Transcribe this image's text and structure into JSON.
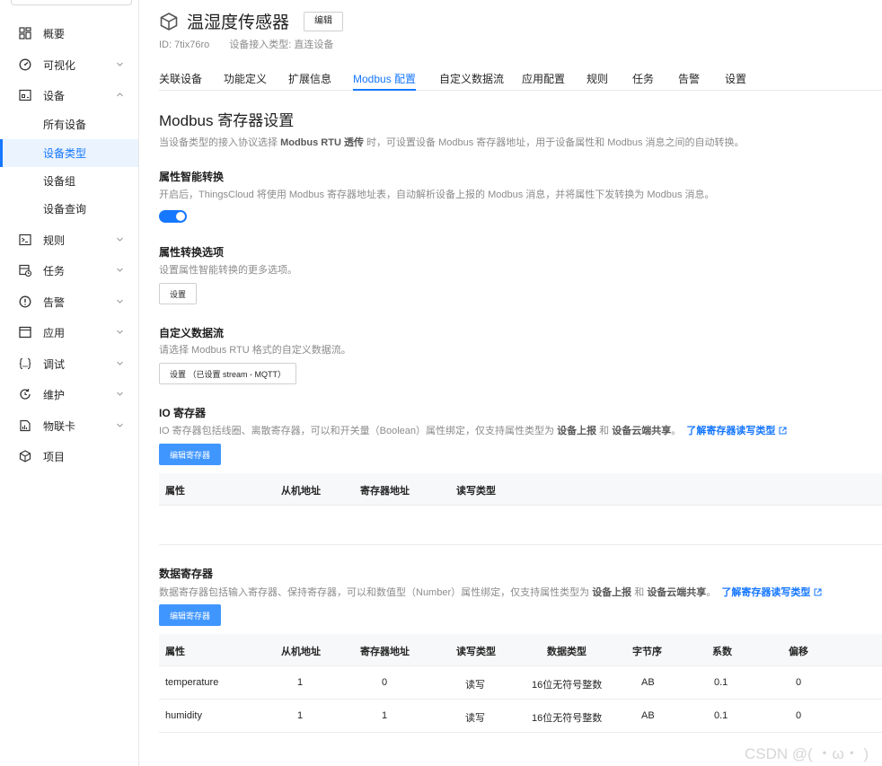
{
  "sidebar": {
    "items": [
      {
        "label": "概要",
        "icon": "dashboard-icon"
      },
      {
        "label": "可视化",
        "icon": "gauge-icon",
        "chevron": "down"
      },
      {
        "label": "设备",
        "icon": "device-icon",
        "chevron": "up"
      },
      {
        "label": "规则",
        "icon": "terminal-icon",
        "chevron": "down"
      },
      {
        "label": "任务",
        "icon": "task-icon",
        "chevron": "down"
      },
      {
        "label": "告警",
        "icon": "alert-icon",
        "chevron": "down"
      },
      {
        "label": "应用",
        "icon": "app-window-icon",
        "chevron": "down"
      },
      {
        "label": "调试",
        "icon": "debug-braces-icon",
        "chevron": "down"
      },
      {
        "label": "维护",
        "icon": "maintenance-icon",
        "chevron": "down"
      },
      {
        "label": "物联卡",
        "icon": "sim-card-icon",
        "chevron": "down"
      },
      {
        "label": "项目",
        "icon": "project-cube-icon"
      }
    ],
    "device_subitems": [
      "所有设备",
      "设备类型",
      "设备组",
      "设备查询"
    ],
    "active_subitem": "设备类型"
  },
  "header": {
    "title": "温湿度传感器",
    "edit_label": "编辑",
    "id_text": "ID: 7tix76ro",
    "access_type_text": "设备接入类型: 直连设备"
  },
  "tabs": [
    "关联设备",
    "功能定义",
    "扩展信息",
    "Modbus 配置",
    "自定义数据流",
    "应用配置",
    "规则",
    "任务",
    "告警",
    "设置"
  ],
  "active_tab": "Modbus 配置",
  "modbus": {
    "heading": "Modbus 寄存器设置",
    "desc_pre": "当设备类型的接入协议选择 ",
    "desc_bold": "Modbus RTU 透传",
    "desc_post": " 时，可设置设备 Modbus 寄存器地址，用于设备属性和 Modbus 消息之间的自动转换。"
  },
  "smart_convert": {
    "heading": "属性智能转换",
    "desc": "开启后，ThingsCloud 将使用 Modbus 寄存器地址表，自动解析设备上报的 Modbus 消息，并将属性下发转换为 Modbus 消息。",
    "enabled": true
  },
  "convert_options": {
    "heading": "属性转换选项",
    "desc": "设置属性智能转换的更多选项。",
    "button_label": "设置"
  },
  "custom_stream": {
    "heading": "自定义数据流",
    "desc": "请选择 Modbus RTU 格式的自定义数据流。",
    "button_label": "设置 （已设置 stream - MQTT）"
  },
  "io_register": {
    "heading": "IO 寄存器",
    "desc_pre": "IO 寄存器包括线圈、离散寄存器，可以和开关量（Boolean）属性绑定，仅支持属性类型为 ",
    "desc_b1": "设备上报",
    "desc_mid": " 和 ",
    "desc_b2": "设备云端共享",
    "desc_end": "。",
    "link": "了解寄存器读写类型",
    "button_label": "编辑寄存器",
    "columns": [
      "属性",
      "从机地址",
      "寄存器地址",
      "读写类型"
    ]
  },
  "data_register": {
    "heading": "数据寄存器",
    "desc_pre": "数据寄存器包括输入寄存器、保持寄存器，可以和数值型（Number）属性绑定，仅支持属性类型为 ",
    "desc_b1": "设备上报",
    "desc_mid": " 和 ",
    "desc_b2": "设备云端共享",
    "desc_end": "。",
    "link": "了解寄存器读写类型",
    "button_label": "编辑寄存器",
    "columns": [
      "属性",
      "从机地址",
      "寄存器地址",
      "读写类型",
      "数据类型",
      "字节序",
      "系数",
      "偏移"
    ],
    "rows": [
      [
        "temperature",
        "1",
        "0",
        "读写",
        "16位无符号整数",
        "AB",
        "0.1",
        "0"
      ],
      [
        "humidity",
        "1",
        "1",
        "读写",
        "16位无符号整数",
        "AB",
        "0.1",
        "0"
      ]
    ]
  },
  "watermark": "CSDN @(  ・ω・ )",
  "colors": {
    "accent": "#1677ff",
    "primary_button": "#4096ff",
    "muted_text": "#8c8c8c"
  }
}
